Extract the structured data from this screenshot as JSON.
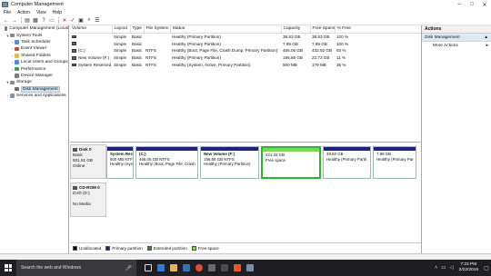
{
  "window": {
    "title": "Computer Management"
  },
  "menubar": [
    "File",
    "Action",
    "View",
    "Help"
  ],
  "tree": [
    {
      "label": "Computer Management (Local",
      "level": 0,
      "arrow": "",
      "icon_color": "#6b7f95"
    },
    {
      "label": "System Tools",
      "level": 1,
      "arrow": "▼",
      "icon_color": "#8a8a8a"
    },
    {
      "label": "Task Scheduler",
      "level": 2,
      "arrow": "›",
      "icon_color": "#5d8fc4"
    },
    {
      "label": "Event Viewer",
      "level": 2,
      "arrow": "›",
      "icon_color": "#c44d3a"
    },
    {
      "label": "Shared Folders",
      "level": 2,
      "arrow": "›",
      "icon_color": "#e1b84a"
    },
    {
      "label": "Local Users and Groups",
      "level": 2,
      "arrow": "›",
      "icon_color": "#5a8ac9"
    },
    {
      "label": "Performance",
      "level": 2,
      "arrow": "›",
      "icon_color": "#3f9b5a"
    },
    {
      "label": "Device Manager",
      "level": 2,
      "arrow": "",
      "icon_color": "#7a7a8a"
    },
    {
      "label": "Storage",
      "level": 1,
      "arrow": "▼",
      "icon_color": "#8a8a8a"
    },
    {
      "label": "Disk Management",
      "level": 2,
      "arrow": "",
      "icon_color": "#6b6b6b",
      "selected": true
    },
    {
      "label": "Services and Applications",
      "level": 1,
      "arrow": "›",
      "icon_color": "#7f95b5"
    }
  ],
  "list": {
    "columns": [
      "Volume",
      "Layout",
      "Type",
      "File System",
      "Status",
      "Capacity",
      "Free Space",
      "% Free"
    ],
    "rows": [
      [
        "",
        "Simple",
        "Basic",
        "",
        "Healthy (Primary Partition)",
        "38.83 GB",
        "38.83 GB",
        "100 %"
      ],
      [
        "",
        "Simple",
        "Basic",
        "",
        "Healthy (Primary Partition)",
        "7.89 GB",
        "7.89 GB",
        "100 %"
      ],
      [
        "(C:)",
        "Simple",
        "Basic",
        "NTFS",
        "Healthy (Boot, Page File, Crash Dump, Primary Partition)",
        "466.06 GB",
        "432.92 GB",
        "93 %"
      ],
      [
        "New Volume (F:)",
        "Simple",
        "Basic",
        "NTFS",
        "Healthy (Primary Partition)",
        "196.88 GB",
        "22.73 GB",
        "11 %"
      ],
      [
        "System Reserved",
        "Simple",
        "Basic",
        "NTFS",
        "Healthy (System, Active, Primary Partition)",
        "500 MB",
        "179 MB",
        "36 %"
      ]
    ]
  },
  "disks": [
    {
      "name": "Disk 0",
      "lines": [
        "Basic",
        "931.51 GB",
        "Online"
      ],
      "partitions": [
        {
          "name": "System Rese",
          "lines": [
            "500 MB NTFS",
            "Healthy (Syst"
          ],
          "strip": "#1a237e"
        },
        {
          "name": "(C:)",
          "lines": [
            "466.06 GB NTFS",
            "Healthy (Boot, Page File, Crash"
          ],
          "strip": "#1a237e"
        },
        {
          "name": "New Volume (F:)",
          "lines": [
            "196.88 GB NTFS",
            "Healthy (Primary Partition)"
          ],
          "strip": "#1a237e"
        },
        {
          "name": "",
          "lines": [
            "221.34 GB",
            "Free space"
          ],
          "strip": "#7ed957",
          "selected": true
        },
        {
          "name": "",
          "lines": [
            "38.83 GB",
            "Healthy (Primary Partit"
          ],
          "strip": "#1a237e"
        },
        {
          "name": "",
          "lines": [
            "7.89 GB",
            "Healthy (Primary Par"
          ],
          "strip": "#1a237e"
        }
      ]
    },
    {
      "name": "CD-ROM 0",
      "lines": [
        "DVD (D:)",
        "",
        "No Media"
      ],
      "partitions": []
    }
  ],
  "legend": [
    {
      "label": "Unallocated",
      "color": "#000000"
    },
    {
      "label": "Primary partition",
      "color": "#1a237e"
    },
    {
      "label": "Extended partition",
      "color": "#2f8a2f"
    },
    {
      "label": "Free space",
      "color": "#7ed957"
    }
  ],
  "actions": {
    "header": "Actions",
    "section": "Disk Management",
    "item": "More Actions"
  },
  "taskbar": {
    "search_placeholder": "Search the web and Windows",
    "time": "7:23 PM",
    "date": "2/22/2016"
  }
}
